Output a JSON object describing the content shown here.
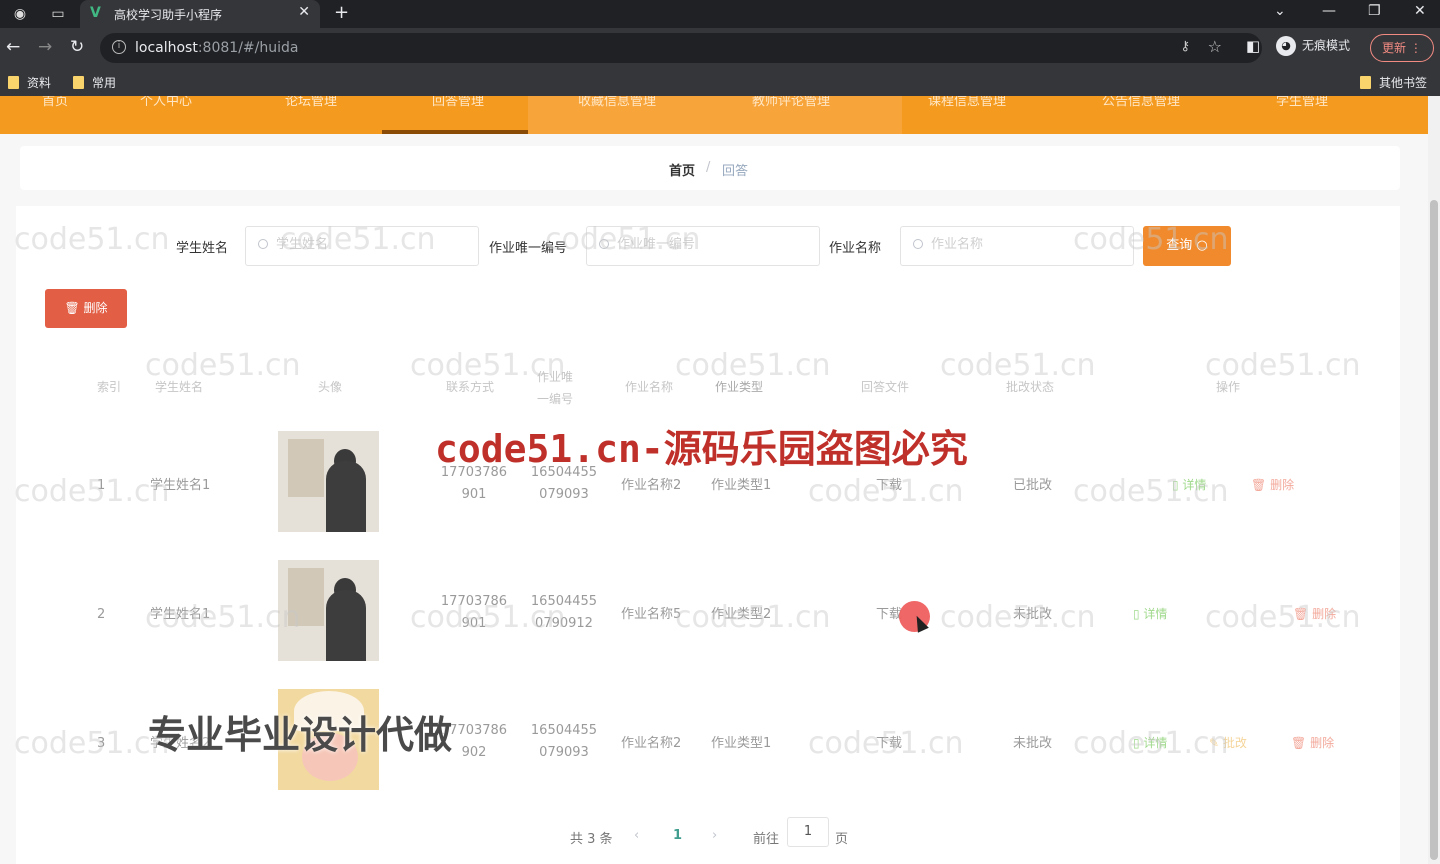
{
  "browser": {
    "tab_title": "高校学习助手小程序",
    "url_host": "localhost",
    "url_rest": ":8081/#/huida",
    "incognito_label": "无痕模式",
    "update_label": "更新",
    "bookmarks": [
      "资料",
      "常用"
    ],
    "other_bookmarks": "其他书签"
  },
  "nav": {
    "items": [
      "首页",
      "个人中心",
      "论坛管理",
      "回答管理",
      "收藏信息管理",
      "教师评论管理",
      "课程信息管理",
      "公告信息管理",
      "学生管理"
    ]
  },
  "breadcrumb": {
    "home": "首页",
    "sep": "/",
    "current": "回答"
  },
  "search": {
    "student_name_label": "学生姓名",
    "student_name_placeholder": "学生姓名",
    "homework_id_label": "作业唯一编号",
    "homework_id_placeholder": "作业唯一编号",
    "homework_name_label": "作业名称",
    "homework_name_placeholder": "作业名称",
    "query_label": "查询"
  },
  "actions": {
    "delete_label": "删除"
  },
  "table": {
    "headers": [
      "索引",
      "学生姓名",
      "头像",
      "联系方式",
      "作业唯一编号",
      "作业名称",
      "作业类型",
      "回答文件",
      "批改状态",
      "操作"
    ],
    "rows": [
      {
        "index": "1",
        "name": "学生姓名1",
        "contact": "17703786901",
        "hw_id": "16504455079093",
        "hw_name": "作业名称2",
        "hw_type": "作业类型1",
        "file": "下载",
        "status": "已批改",
        "detail": "详情",
        "correct": "",
        "delete": "删除"
      },
      {
        "index": "2",
        "name": "学生姓名1",
        "contact": "17703786901",
        "hw_id": "165044550790912",
        "hw_name": "作业名称5",
        "hw_type": "作业类型2",
        "file": "下载",
        "status": "未批改",
        "detail": "详情",
        "correct": "",
        "delete": "删除"
      },
      {
        "index": "3",
        "name": "学生姓名2",
        "contact": "17703786902",
        "hw_id": "16504455079093",
        "hw_name": "作业名称2",
        "hw_type": "作业类型1",
        "file": "下载",
        "status": "未批改",
        "detail": "详情",
        "correct": "批改",
        "delete": "删除"
      }
    ]
  },
  "pagination": {
    "total": "共 3 条",
    "current": "1",
    "goto": "前往",
    "page_value": "1",
    "page_suffix": "页"
  },
  "watermark": {
    "text": "code51.cn",
    "banner": "code51.cn-源码乐园盗图必究",
    "stamp": "专业毕业设计代做"
  },
  "colors": {
    "accent": "#f39a1f",
    "danger": "#e25e44",
    "success": "#67c23a"
  }
}
